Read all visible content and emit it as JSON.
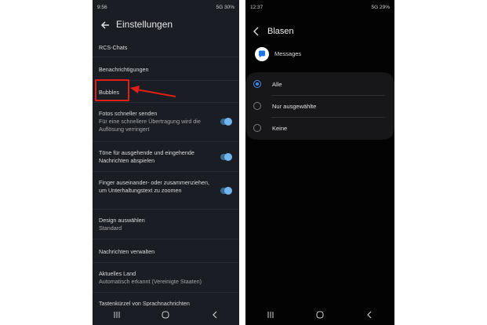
{
  "left": {
    "status": {
      "time": "9:56",
      "right": "5G 30%"
    },
    "title": "Einstellungen",
    "items": [
      {
        "label": "RCS-Chats"
      },
      {
        "label": "Benachrichtigungen"
      },
      {
        "label": "Bubbles"
      },
      {
        "label": "Fotos schneller senden",
        "sub": "Für eine schnellere Übertragung wird die Auflösung verringert",
        "toggle": true
      },
      {
        "label": "Töne für ausgehende und eingehende Nachrichten abspielen",
        "toggle": true
      },
      {
        "label": "Finger auseinander- oder zusammenziehen, um Unterhaltungstext zu zoomen",
        "toggle": true
      },
      {
        "label": "Design auswählen",
        "sub": "Standard"
      },
      {
        "label": "Nachrichten verwalten"
      },
      {
        "label": "Aktuelles Land",
        "sub": "Automatisch erkannt (Vereinigte Staaten)"
      },
      {
        "label": "Tastenkürzel von Sprachnachrichten"
      }
    ],
    "highlight_color": "#e02018"
  },
  "right": {
    "status": {
      "time": "12:37",
      "right": "5G 29%"
    },
    "title": "Blasen",
    "app_name": "Messages",
    "options": [
      {
        "label": "Alle",
        "selected": true
      },
      {
        "label": "Nur ausgewählte",
        "selected": false
      },
      {
        "label": "Keine",
        "selected": false
      }
    ],
    "accent": "#3d8bf2"
  }
}
